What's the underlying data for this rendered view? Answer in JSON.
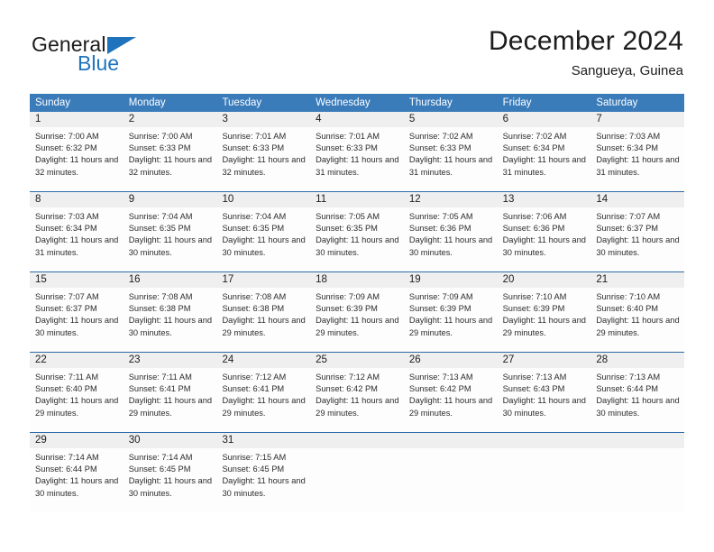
{
  "brand": {
    "line1": "General",
    "line2": "Blue",
    "mark": "triangle-logo-mark",
    "color_primary": "#1f73bd",
    "color_text": "#1c1c1c"
  },
  "header": {
    "title": "December 2024",
    "subtitle": "Sangueya, Guinea"
  },
  "theme": {
    "header_blue": "#3a7bba",
    "row_divider_blue": "#2f6ca8",
    "day_number_band": "#efefef",
    "cell_background": "#fdfdfd"
  },
  "weekdays": [
    {
      "label": "Sunday"
    },
    {
      "label": "Monday"
    },
    {
      "label": "Tuesday"
    },
    {
      "label": "Wednesday"
    },
    {
      "label": "Thursday"
    },
    {
      "label": "Friday"
    },
    {
      "label": "Saturday"
    }
  ],
  "weeks": [
    {
      "days": [
        {
          "date": "1",
          "sunrise": "Sunrise: 7:00 AM",
          "sunset": "Sunset: 6:32 PM",
          "daylight": "Daylight: 11 hours and 32 minutes."
        },
        {
          "date": "2",
          "sunrise": "Sunrise: 7:00 AM",
          "sunset": "Sunset: 6:33 PM",
          "daylight": "Daylight: 11 hours and 32 minutes."
        },
        {
          "date": "3",
          "sunrise": "Sunrise: 7:01 AM",
          "sunset": "Sunset: 6:33 PM",
          "daylight": "Daylight: 11 hours and 32 minutes."
        },
        {
          "date": "4",
          "sunrise": "Sunrise: 7:01 AM",
          "sunset": "Sunset: 6:33 PM",
          "daylight": "Daylight: 11 hours and 31 minutes."
        },
        {
          "date": "5",
          "sunrise": "Sunrise: 7:02 AM",
          "sunset": "Sunset: 6:33 PM",
          "daylight": "Daylight: 11 hours and 31 minutes."
        },
        {
          "date": "6",
          "sunrise": "Sunrise: 7:02 AM",
          "sunset": "Sunset: 6:34 PM",
          "daylight": "Daylight: 11 hours and 31 minutes."
        },
        {
          "date": "7",
          "sunrise": "Sunrise: 7:03 AM",
          "sunset": "Sunset: 6:34 PM",
          "daylight": "Daylight: 11 hours and 31 minutes."
        }
      ]
    },
    {
      "days": [
        {
          "date": "8",
          "sunrise": "Sunrise: 7:03 AM",
          "sunset": "Sunset: 6:34 PM",
          "daylight": "Daylight: 11 hours and 31 minutes."
        },
        {
          "date": "9",
          "sunrise": "Sunrise: 7:04 AM",
          "sunset": "Sunset: 6:35 PM",
          "daylight": "Daylight: 11 hours and 30 minutes."
        },
        {
          "date": "10",
          "sunrise": "Sunrise: 7:04 AM",
          "sunset": "Sunset: 6:35 PM",
          "daylight": "Daylight: 11 hours and 30 minutes."
        },
        {
          "date": "11",
          "sunrise": "Sunrise: 7:05 AM",
          "sunset": "Sunset: 6:35 PM",
          "daylight": "Daylight: 11 hours and 30 minutes."
        },
        {
          "date": "12",
          "sunrise": "Sunrise: 7:05 AM",
          "sunset": "Sunset: 6:36 PM",
          "daylight": "Daylight: 11 hours and 30 minutes."
        },
        {
          "date": "13",
          "sunrise": "Sunrise: 7:06 AM",
          "sunset": "Sunset: 6:36 PM",
          "daylight": "Daylight: 11 hours and 30 minutes."
        },
        {
          "date": "14",
          "sunrise": "Sunrise: 7:07 AM",
          "sunset": "Sunset: 6:37 PM",
          "daylight": "Daylight: 11 hours and 30 minutes."
        }
      ]
    },
    {
      "days": [
        {
          "date": "15",
          "sunrise": "Sunrise: 7:07 AM",
          "sunset": "Sunset: 6:37 PM",
          "daylight": "Daylight: 11 hours and 30 minutes."
        },
        {
          "date": "16",
          "sunrise": "Sunrise: 7:08 AM",
          "sunset": "Sunset: 6:38 PM",
          "daylight": "Daylight: 11 hours and 30 minutes."
        },
        {
          "date": "17",
          "sunrise": "Sunrise: 7:08 AM",
          "sunset": "Sunset: 6:38 PM",
          "daylight": "Daylight: 11 hours and 29 minutes."
        },
        {
          "date": "18",
          "sunrise": "Sunrise: 7:09 AM",
          "sunset": "Sunset: 6:39 PM",
          "daylight": "Daylight: 11 hours and 29 minutes."
        },
        {
          "date": "19",
          "sunrise": "Sunrise: 7:09 AM",
          "sunset": "Sunset: 6:39 PM",
          "daylight": "Daylight: 11 hours and 29 minutes."
        },
        {
          "date": "20",
          "sunrise": "Sunrise: 7:10 AM",
          "sunset": "Sunset: 6:39 PM",
          "daylight": "Daylight: 11 hours and 29 minutes."
        },
        {
          "date": "21",
          "sunrise": "Sunrise: 7:10 AM",
          "sunset": "Sunset: 6:40 PM",
          "daylight": "Daylight: 11 hours and 29 minutes."
        }
      ]
    },
    {
      "days": [
        {
          "date": "22",
          "sunrise": "Sunrise: 7:11 AM",
          "sunset": "Sunset: 6:40 PM",
          "daylight": "Daylight: 11 hours and 29 minutes."
        },
        {
          "date": "23",
          "sunrise": "Sunrise: 7:11 AM",
          "sunset": "Sunset: 6:41 PM",
          "daylight": "Daylight: 11 hours and 29 minutes."
        },
        {
          "date": "24",
          "sunrise": "Sunrise: 7:12 AM",
          "sunset": "Sunset: 6:41 PM",
          "daylight": "Daylight: 11 hours and 29 minutes."
        },
        {
          "date": "25",
          "sunrise": "Sunrise: 7:12 AM",
          "sunset": "Sunset: 6:42 PM",
          "daylight": "Daylight: 11 hours and 29 minutes."
        },
        {
          "date": "26",
          "sunrise": "Sunrise: 7:13 AM",
          "sunset": "Sunset: 6:42 PM",
          "daylight": "Daylight: 11 hours and 29 minutes."
        },
        {
          "date": "27",
          "sunrise": "Sunrise: 7:13 AM",
          "sunset": "Sunset: 6:43 PM",
          "daylight": "Daylight: 11 hours and 30 minutes."
        },
        {
          "date": "28",
          "sunrise": "Sunrise: 7:13 AM",
          "sunset": "Sunset: 6:44 PM",
          "daylight": "Daylight: 11 hours and 30 minutes."
        }
      ]
    },
    {
      "days": [
        {
          "date": "29",
          "sunrise": "Sunrise: 7:14 AM",
          "sunset": "Sunset: 6:44 PM",
          "daylight": "Daylight: 11 hours and 30 minutes."
        },
        {
          "date": "30",
          "sunrise": "Sunrise: 7:14 AM",
          "sunset": "Sunset: 6:45 PM",
          "daylight": "Daylight: 11 hours and 30 minutes."
        },
        {
          "date": "31",
          "sunrise": "Sunrise: 7:15 AM",
          "sunset": "Sunset: 6:45 PM",
          "daylight": "Daylight: 11 hours and 30 minutes."
        },
        {
          "date": "",
          "sunrise": "",
          "sunset": "",
          "daylight": ""
        },
        {
          "date": "",
          "sunrise": "",
          "sunset": "",
          "daylight": ""
        },
        {
          "date": "",
          "sunrise": "",
          "sunset": "",
          "daylight": ""
        },
        {
          "date": "",
          "sunrise": "",
          "sunset": "",
          "daylight": ""
        }
      ]
    }
  ]
}
